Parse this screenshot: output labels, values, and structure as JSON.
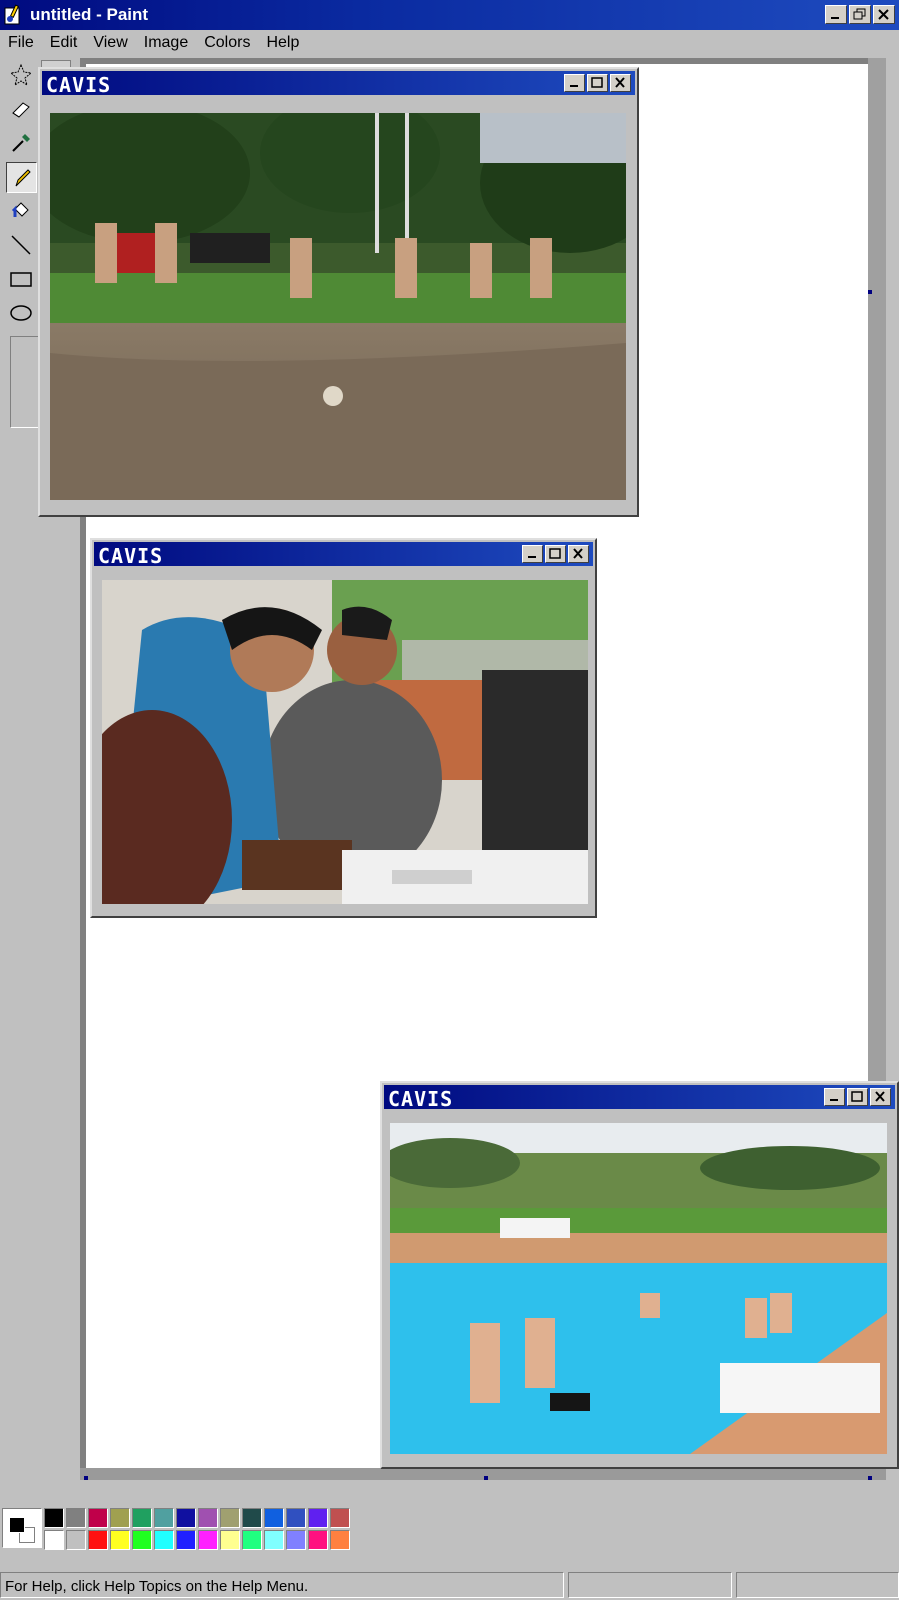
{
  "window": {
    "title": "untitled - Paint",
    "icon": "paint-app-icon"
  },
  "menu": [
    "File",
    "Edit",
    "View",
    "Image",
    "Colors",
    "Help"
  ],
  "tools": [
    {
      "name": "free-form-select",
      "icon": "star-select-icon"
    },
    {
      "name": "eraser",
      "icon": "eraser-icon"
    },
    {
      "name": "pick-color",
      "icon": "eyedropper-icon"
    },
    {
      "name": "pencil",
      "icon": "pencil-icon",
      "pressed": true
    },
    {
      "name": "fill",
      "icon": "fill-bucket-icon"
    },
    {
      "name": "line",
      "icon": "line-icon"
    },
    {
      "name": "rectangle",
      "icon": "rectangle-icon"
    },
    {
      "name": "ellipse",
      "icon": "ellipse-icon"
    }
  ],
  "windows": [
    {
      "title": "CAVIS",
      "photo": "girls-soccer-on-dirt-field"
    },
    {
      "title": "CAVIS",
      "photo": "students-woodcut-printing"
    },
    {
      "title": "CAVIS",
      "photo": "swimming-pool-friends"
    }
  ],
  "palette": {
    "foreground": "#000000",
    "background": "#ffffff",
    "colors": [
      "#000000",
      "#808080",
      "#c0004a",
      "#a0a050",
      "#20a060",
      "#50a0a0",
      "#1010a0",
      "#a050b0",
      "#a0a070",
      "#204a4a",
      "#1060e0",
      "#3050c0",
      "#6020f0",
      "#c05050",
      "#ffffff",
      "#c0c0c0",
      "#ff1010",
      "#ffff20",
      "#20ff20",
      "#20ffff",
      "#2020ff",
      "#ff20ff",
      "#ffff90",
      "#20ff80",
      "#80ffff",
      "#8080ff",
      "#ff1080",
      "#ff8040"
    ]
  },
  "status": {
    "help_text": "For Help, click Help Topics on the Help Menu."
  }
}
